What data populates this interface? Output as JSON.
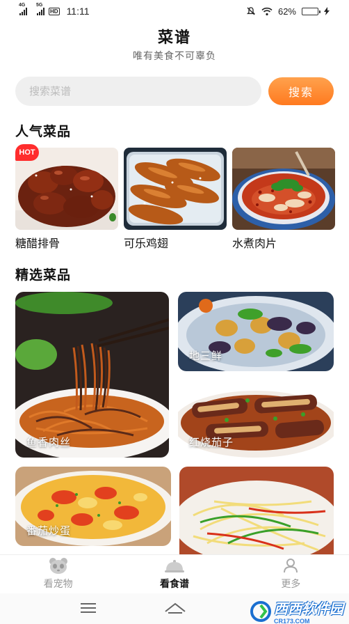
{
  "status_bar": {
    "network_1": "4G",
    "network_2": "5G",
    "hd": "HD",
    "time": "11:11",
    "battery": "62%",
    "battery_level": 0.62
  },
  "header": {
    "title": "菜谱",
    "subtitle": "唯有美食不可辜负"
  },
  "search": {
    "placeholder": "搜索菜谱",
    "button_label": "搜索"
  },
  "popular": {
    "title": "人气菜品",
    "badge": "HOT",
    "items": [
      {
        "name": "糖醋排骨"
      },
      {
        "name": "可乐鸡翅"
      },
      {
        "name": "水煮肉片"
      }
    ]
  },
  "featured": {
    "title": "精选菜品",
    "items": [
      {
        "name": "鱼香肉丝"
      },
      {
        "name": "地三鲜"
      },
      {
        "name": "红烧茄子"
      },
      {
        "name": "番茄炒蛋"
      },
      {
        "name": ""
      }
    ]
  },
  "bottom_nav": {
    "items": [
      {
        "label": "看宠物",
        "icon": "panda-icon"
      },
      {
        "label": "看食谱",
        "icon": "cloche-icon",
        "active": true
      },
      {
        "label": "更多",
        "icon": "user-icon"
      }
    ]
  },
  "watermark": {
    "brand": "西西软件园",
    "url": "CR173.COM"
  },
  "colors": {
    "accent": "#ff8a2a",
    "hot": "#ff2d2d"
  }
}
